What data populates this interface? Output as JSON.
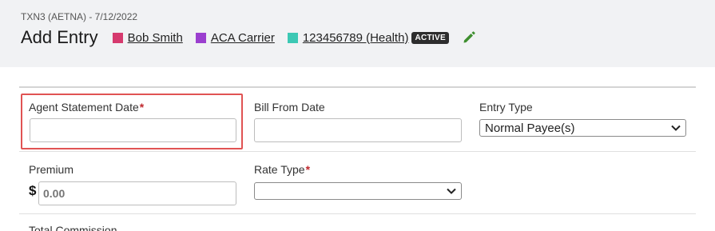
{
  "header": {
    "breadcrumb": "TXN3 (AETNA) - 7/12/2022",
    "title": "Add Entry",
    "chips": [
      {
        "label": "Bob Smith",
        "color": "#d63a6e"
      },
      {
        "label": "ACA Carrier",
        "color": "#9b3fcf"
      },
      {
        "label": "123456789 (Health)",
        "color": "#3cc8b4"
      }
    ],
    "status_badge": "ACTIVE",
    "edit_icon": "pencil-icon"
  },
  "form": {
    "agent_statement_date": {
      "label": "Agent Statement Date",
      "required_mark": "*",
      "value": ""
    },
    "bill_from_date": {
      "label": "Bill From Date",
      "value": ""
    },
    "entry_type": {
      "label": "Entry Type",
      "selected": "Normal Payee(s)"
    },
    "premium": {
      "label": "Premium",
      "currency": "$",
      "placeholder": "0.00"
    },
    "rate_type": {
      "label": "Rate Type",
      "required_mark": "*",
      "selected": ""
    },
    "total_commission": {
      "label": "Total Commission"
    }
  },
  "colors": {
    "highlight": "#e05353",
    "required": "#c0282d",
    "edit_icon": "#3f8f2f"
  }
}
